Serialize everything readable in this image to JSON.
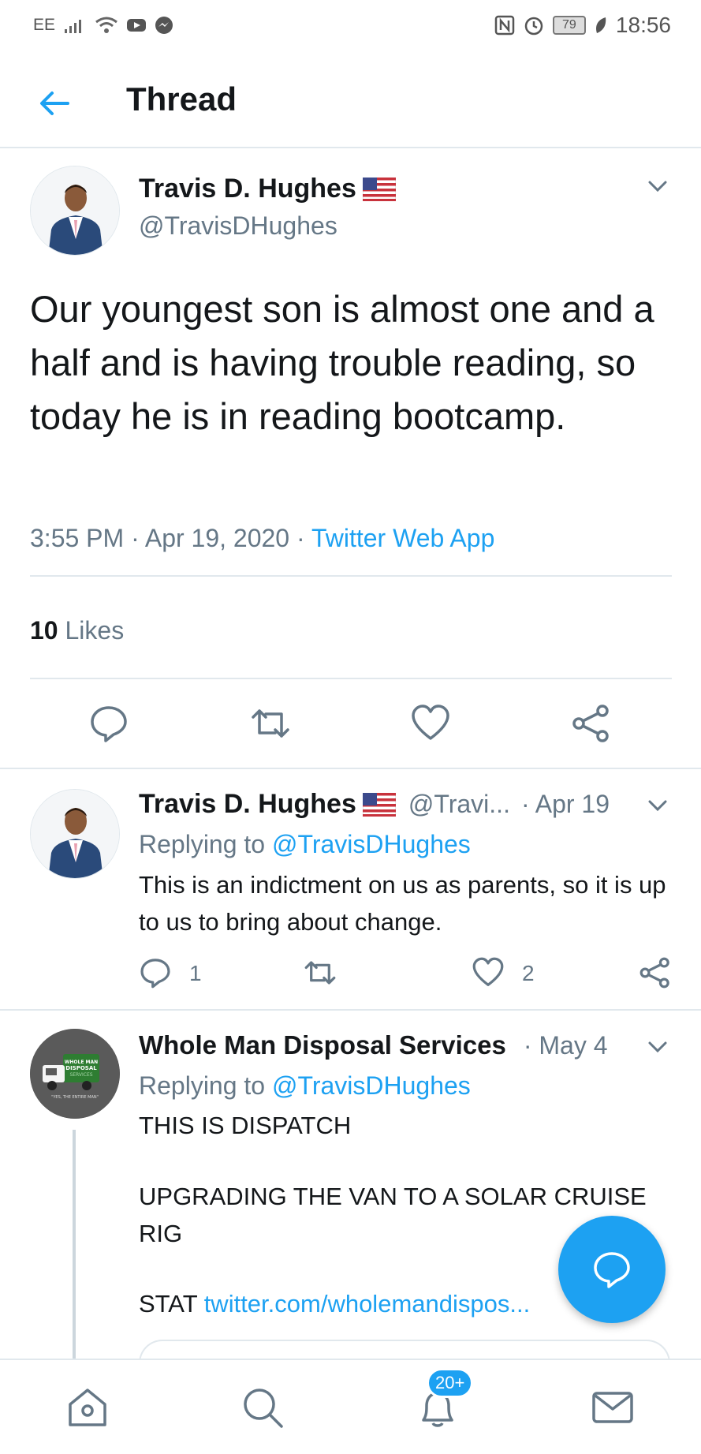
{
  "status_bar": {
    "carrier": "EE",
    "battery": "79",
    "time": "18:56"
  },
  "header": {
    "title": "Thread"
  },
  "main_tweet": {
    "name": "Travis D. Hughes",
    "handle": "@TravisDHughes",
    "text": "Our youngest son is almost one and a half and is having trouble reading, so today he is in reading bootcamp.",
    "time": "3:55 PM · Apr 19, 2020 · ",
    "source": "Twitter Web App",
    "likes_count": "10",
    "likes_label": "Likes"
  },
  "reply1": {
    "name": "Travis D. Hughes",
    "handle": "@Travi...",
    "date": "· Apr 19",
    "replying_prefix": "Replying to ",
    "replying_to": "@TravisDHughes",
    "text": "This is an indictment on us as parents, so it is up to us to bring about change.",
    "reply_count": "1",
    "like_count": "2"
  },
  "reply2": {
    "name": "Whole Man Disposal Services",
    "date": "· May 4",
    "replying_prefix": "Replying to ",
    "replying_to": "@TravisDHughes",
    "line1": "THIS IS DISPATCH",
    "line2": "UPGRADING THE VAN TO A SOLAR CRUISE RIG",
    "line3_prefix": "STAT ",
    "line3_link": "twitter.com/wholemandispos...",
    "logo_text_1": "WHOLE MAN",
    "logo_text_2": "DISPOSAL",
    "logo_text_3": "SERVICES",
    "logo_tagline": "\"YES, THE ENTIRE MAN\""
  },
  "bottom_nav": {
    "notifications_badge": "20+"
  },
  "colors": {
    "accent": "#1da1f2",
    "text": "#14171a",
    "muted": "#657786",
    "divider": "#e1e8ed"
  }
}
